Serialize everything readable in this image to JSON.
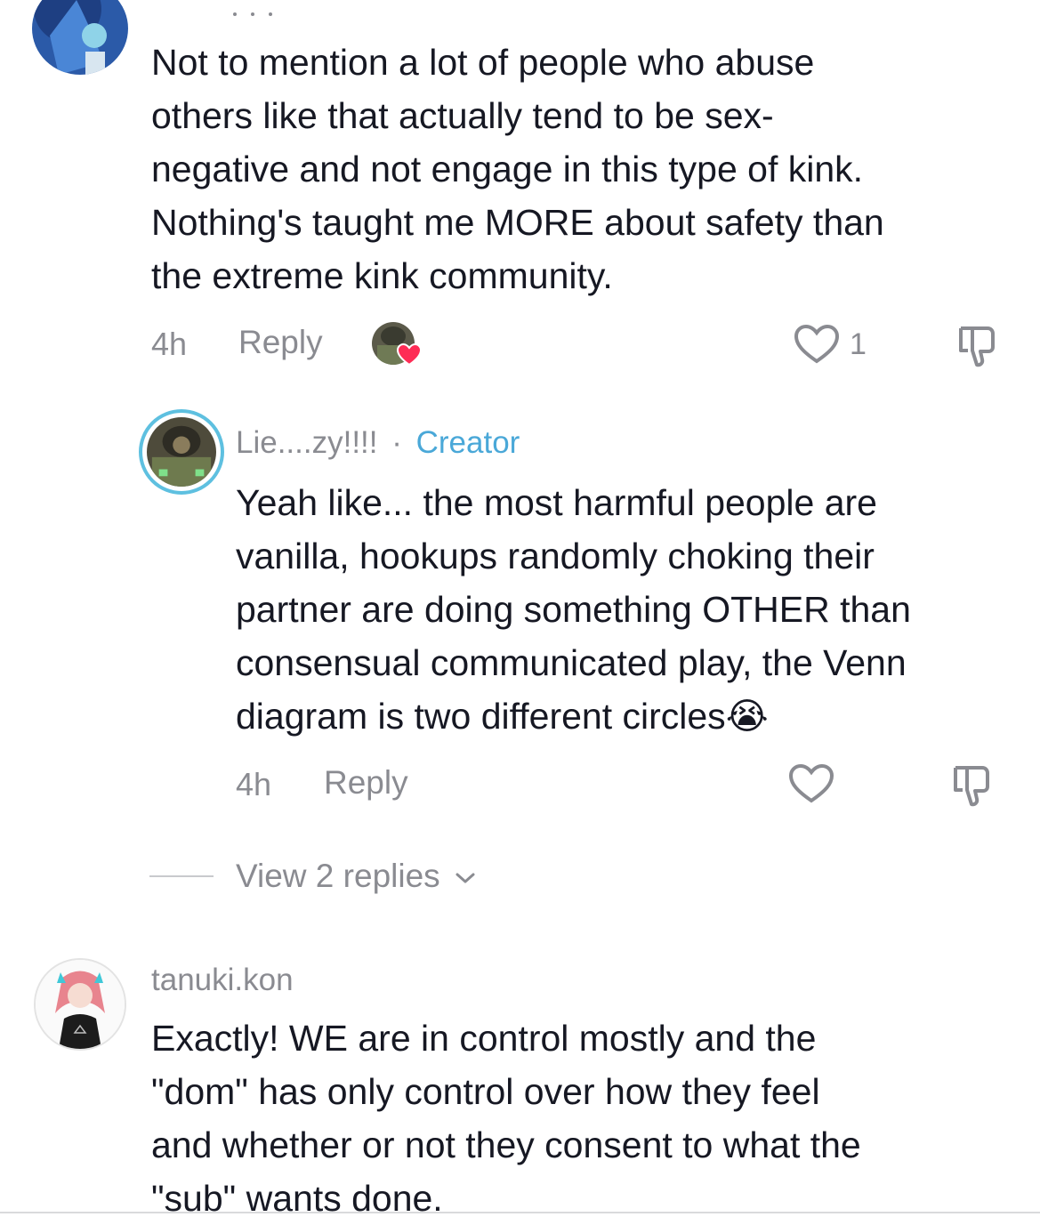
{
  "comments": [
    {
      "text_lines": [
        "Not to mention a lot of people who abuse",
        "others like that actually tend to be sex-",
        "negative and not engage in this type of kink.",
        "Nothing's taught me MORE about safety than",
        "the extreme kink community."
      ],
      "time": "4h",
      "reply_label": "Reply",
      "likes": "1"
    },
    {
      "username": "Lie....zy!!!!",
      "separator": "·",
      "badge": "Creator",
      "text_lines": [
        "Yeah like... the most harmful people are",
        "vanilla, hookups randomly choking their",
        "partner are doing something OTHER than",
        "consensual communicated play, the Venn",
        "diagram is two different circles"
      ],
      "emoji": "😭",
      "time": "4h",
      "reply_label": "Reply",
      "view_replies": "View 2 replies"
    },
    {
      "username": "tanuki.kon",
      "text_lines": [
        "Exactly! WE are in control mostly and the",
        "\"dom\" has only control over how they feel",
        "and whether or not they consent to what the",
        "\"sub\" wants done."
      ]
    }
  ],
  "colors": {
    "creator": "#4aa8d8",
    "meta": "#8a8b91",
    "text": "#161823",
    "heart": "#fe2c55"
  }
}
